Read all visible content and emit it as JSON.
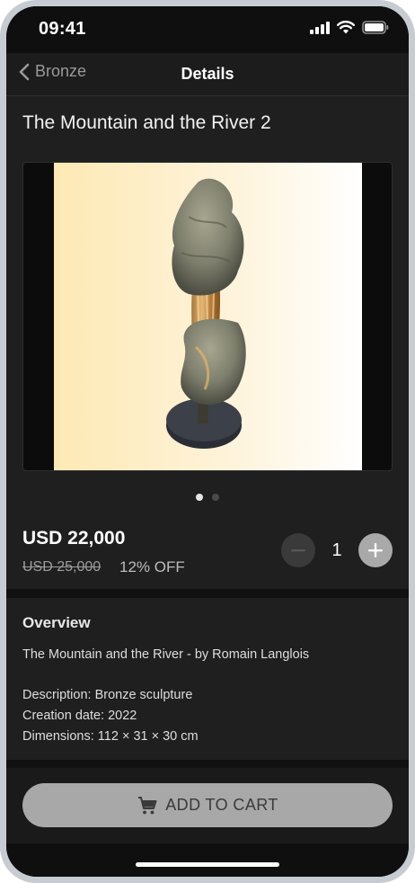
{
  "status_bar": {
    "time": "09:41"
  },
  "nav": {
    "back_label": "Bronze",
    "title": "Details"
  },
  "product": {
    "title": "The Mountain and the River 2",
    "price": "USD 22,000",
    "original_price": "USD 25,000",
    "discount": "12% OFF",
    "quantity": "1",
    "gallery": {
      "total_images": 2,
      "active_index": 0
    }
  },
  "overview": {
    "heading": "Overview",
    "subtitle": "The Mountain and the River - by Romain Langlois",
    "description": "Description: Bronze sculpture",
    "creation_date": "Creation date: 2022",
    "dimensions": "Dimensions: 112 × 31 × 30 cm"
  },
  "cta": {
    "label": "ADD TO CART",
    "icon": "cart-icon"
  },
  "colors": {
    "background": "#1f1f1f",
    "cta_bg": "#a8a8a8",
    "plus_button": "#a9a9a9",
    "minus_button": "#3a3a3a"
  }
}
